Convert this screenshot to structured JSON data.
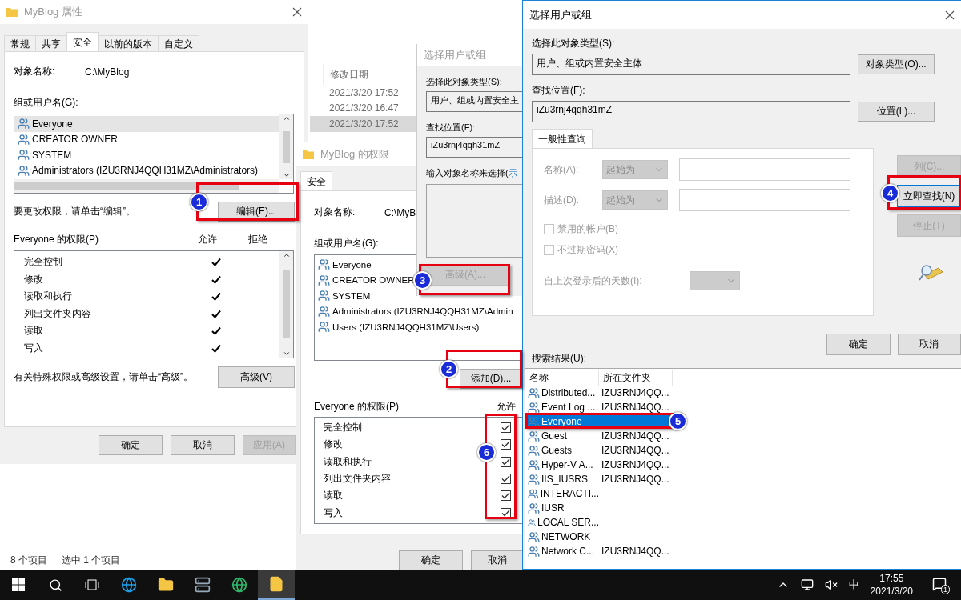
{
  "explorer": {
    "column_header": "修改日期",
    "dates": [
      {
        "text": "2021/3/20 17:52",
        "selected": false
      },
      {
        "text": "2021/3/20 16:47",
        "selected": false
      },
      {
        "text": "2021/3/20 17:52",
        "selected": true
      }
    ],
    "status": [
      "8 个项目",
      "选中 1 个项目"
    ]
  },
  "properties_window": {
    "title": "MyBlog 属性",
    "tabs": [
      {
        "label": "常规",
        "selected": false
      },
      {
        "label": "共享",
        "selected": false
      },
      {
        "label": "安全",
        "selected": true
      },
      {
        "label": "以前的版本",
        "selected": false
      },
      {
        "label": "自定义",
        "selected": false
      }
    ],
    "object_label": "对象名称:",
    "object_value": "C:\\MyBlog",
    "users_label": "组或用户名(G):",
    "users": [
      {
        "name": "Everyone",
        "selected": true
      },
      {
        "name": "CREATOR OWNER",
        "selected": false
      },
      {
        "name": "SYSTEM",
        "selected": false
      },
      {
        "name": "Administrators (IZU3RNJ4QQH31MZ\\Administrators)",
        "selected": false
      }
    ],
    "edit_hint": "要更改权限，请单击“编辑”。",
    "edit_button": "编辑(E)...",
    "permissions_label": "Everyone 的权限(P)",
    "allow_header": "允许",
    "deny_header": "拒绝",
    "permissions": [
      {
        "name": "完全控制",
        "allow": true,
        "deny": false
      },
      {
        "name": "修改",
        "allow": true,
        "deny": false
      },
      {
        "name": "读取和执行",
        "allow": true,
        "deny": false
      },
      {
        "name": "列出文件夹内容",
        "allow": true,
        "deny": false
      },
      {
        "name": "读取",
        "allow": true,
        "deny": false
      },
      {
        "name": "写入",
        "allow": true,
        "deny": false
      }
    ],
    "advanced_hint": "有关特殊权限或高级设置，请单击“高级”。",
    "advanced_button": "高级(V)",
    "buttons": [
      {
        "label": "确定",
        "disabled": false
      },
      {
        "label": "取消",
        "disabled": false
      },
      {
        "label": "应用(A)",
        "disabled": true
      }
    ]
  },
  "permissions_window": {
    "title": "MyBlog 的权限",
    "tabs": [
      {
        "label": "安全",
        "selected": true
      }
    ],
    "object_label": "对象名称:",
    "object_value": "C:\\MyB",
    "users_label": "组或用户名(G):",
    "users": [
      {
        "name": "Everyone",
        "selected": false
      },
      {
        "name": "CREATOR OWNER",
        "selected": false
      },
      {
        "name": "SYSTEM",
        "selected": false
      },
      {
        "name": "Administrators (IZU3RNJ4QQH31MZ\\Admin",
        "selected": false
      },
      {
        "name": "Users (IZU3RNJ4QQH31MZ\\Users)",
        "selected": false
      }
    ],
    "add_button": "添加(D)...",
    "permissions_label": "Everyone 的权限(P)",
    "allow_header": "允许",
    "permissions": [
      {
        "name": "完全控制",
        "allow": true
      },
      {
        "name": "修改",
        "allow": true
      },
      {
        "name": "读取和执行",
        "allow": true
      },
      {
        "name": "列出文件夹内容",
        "allow": true
      },
      {
        "name": "读取",
        "allow": true
      },
      {
        "name": "写入",
        "allow": true
      }
    ],
    "buttons": [
      {
        "label": "确定",
        "disabled": false
      },
      {
        "label": "取消",
        "disabled": false
      }
    ]
  },
  "select_window_behind": {
    "title": "选择用户或组",
    "type_label": "选择此对象类型(S):",
    "type_value": "用户、组或内置安全主",
    "location_label": "查找位置(F):",
    "location_value": "iZu3rnj4qqh31mZ",
    "names_label": "输入对象名称来选择(",
    "names_link": "示",
    "advanced_button": {
      "label": "高级(A)...",
      "disabled": true
    }
  },
  "select_window": {
    "title": "选择用户或组",
    "type_label": "选择此对象类型(S):",
    "type_value": "用户、组或内置安全主体",
    "type_button": "对象类型(O)...",
    "location_label": "查找位置(F):",
    "location_value": "iZu3rnj4qqh31mZ",
    "location_button": "位置(L)...",
    "tabs": [
      {
        "label": "一般性查询",
        "selected": true
      }
    ],
    "query": {
      "name_label": "名称(A):",
      "name_mode": "起始为",
      "desc_label": "描述(D):",
      "desc_mode": "起始为",
      "checks": [
        {
          "label": "禁用的帐户(B)",
          "checked": false
        },
        {
          "label": "不过期密码(X)",
          "checked": false
        }
      ],
      "days_label": "自上次登录后的天数(I):",
      "disabled": true
    },
    "side_buttons": [
      {
        "label": "列(C)...",
        "disabled": true
      },
      {
        "label": "立即查找(N)",
        "disabled": false
      },
      {
        "label": "停止(T)",
        "disabled": true
      }
    ],
    "buttons": [
      {
        "label": "确定",
        "disabled": false
      },
      {
        "label": "取消",
        "disabled": false
      }
    ],
    "results_label": "搜索结果(U):",
    "columns": [
      "名称",
      "所在文件夹"
    ],
    "results": [
      {
        "name": "Distributed...",
        "folder": "IZU3RNJ4QQ...",
        "selected": false
      },
      {
        "name": "Event Log ...",
        "folder": "IZU3RNJ4QQ...",
        "selected": false
      },
      {
        "name": "Everyone",
        "selected": true
      },
      {
        "name": "Guest",
        "folder": "IZU3RNJ4QQ...",
        "selected": false
      },
      {
        "name": "Guests",
        "folder": "IZU3RNJ4QQ...",
        "selected": false
      },
      {
        "name": "Hyper-V A...",
        "folder": "IZU3RNJ4QQ...",
        "selected": false
      },
      {
        "name": "IIS_IUSRS",
        "folder": "IZU3RNJ4QQ...",
        "selected": false
      },
      {
        "name": "INTERACTI...",
        "selected": false
      },
      {
        "name": "IUSR",
        "selected": false
      },
      {
        "name": "LOCAL SER...",
        "selected": false
      },
      {
        "name": "NETWORK",
        "selected": false
      },
      {
        "name": "Network C...",
        "folder": "IZU3RNJ4QQ...",
        "selected": false
      }
    ]
  },
  "annotations": [
    {
      "number": "1"
    },
    {
      "number": "2"
    },
    {
      "number": "3"
    },
    {
      "number": "4"
    },
    {
      "number": "5"
    },
    {
      "number": "6"
    }
  ],
  "taskbar": {
    "ime": "中",
    "time": "17:55",
    "date": "2021/3/20",
    "notifications": "1"
  }
}
